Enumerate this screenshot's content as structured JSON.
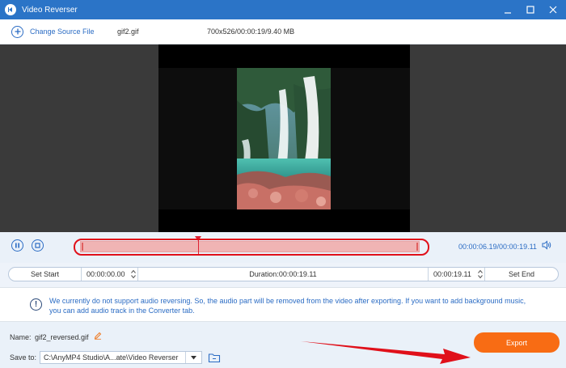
{
  "window": {
    "title": "Video Reverser"
  },
  "toolbar": {
    "change_source_label": "Change Source File",
    "file_name": "gif2.gif",
    "file_meta": "700x526/00:00:19/9.40 MB"
  },
  "playback": {
    "time_display": "00:00:06.19/00:00:19.11",
    "playhead_fraction": 0.347
  },
  "range": {
    "set_start_label": "Set Start",
    "start_time": "00:00:00.00",
    "duration_label": "Duration:00:00:19.11",
    "end_time": "00:00:19.11",
    "set_end_label": "Set End"
  },
  "notice": {
    "message": "We currently do not support audio reversing. So, the audio part will be removed from the video after exporting. If you want to add background music, you can add audio track in the Converter tab."
  },
  "output": {
    "name_label": "Name:",
    "name_value": "gif2_reversed.gif",
    "save_to_label": "Save to:",
    "save_to_value": "C:\\AnyMP4 Studio\\A...ate\\Video Reverser",
    "export_label": "Export"
  },
  "colors": {
    "accent": "#2b74c7",
    "export": "#f86c14",
    "highlight": "#e0101a"
  },
  "icons": [
    "app-icon",
    "minimize-icon",
    "maximize-icon",
    "close-icon",
    "plus-icon",
    "pause-icon",
    "stop-icon",
    "volume-icon",
    "info-icon",
    "pencil-icon",
    "chevron-down-icon",
    "folder-icon"
  ]
}
